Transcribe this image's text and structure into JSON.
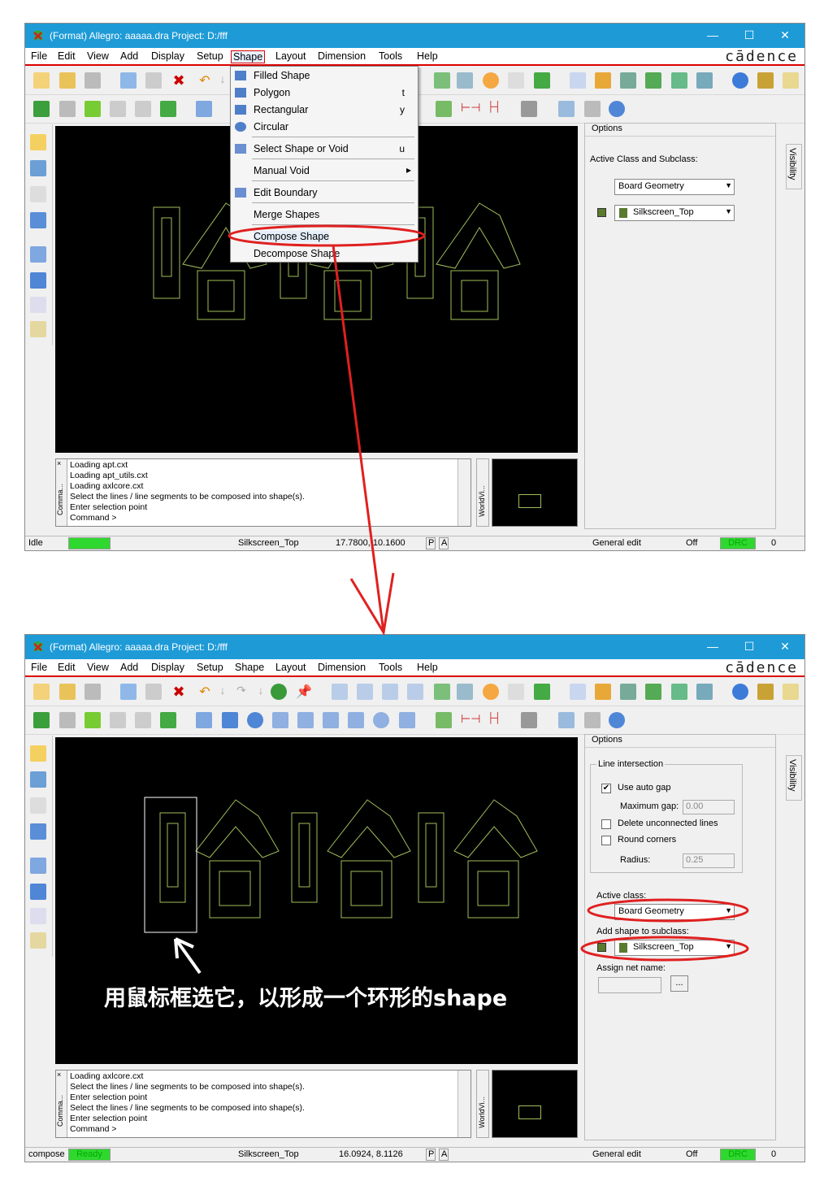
{
  "title": "(Format) Allegro: aaaaa.dra  Project: D:/fff",
  "brand": "cādence",
  "menubar": [
    "File",
    "Edit",
    "View",
    "Add",
    "Display",
    "Setup",
    "Shape",
    "Layout",
    "Dimension",
    "Tools",
    "Help"
  ],
  "shape_menu": {
    "items": [
      {
        "label": "Filled Shape",
        "shortcut": ""
      },
      {
        "label": "Polygon",
        "shortcut": "t"
      },
      {
        "label": "Rectangular",
        "shortcut": "y"
      },
      {
        "label": "Circular",
        "shortcut": ""
      },
      {
        "label": "Select Shape or Void",
        "shortcut": "u"
      },
      {
        "label": "Manual Void",
        "shortcut": "▸"
      },
      {
        "label": "Edit Boundary",
        "shortcut": ""
      },
      {
        "label": "Merge Shapes",
        "shortcut": ""
      },
      {
        "label": "Compose Shape",
        "shortcut": ""
      },
      {
        "label": "Decompose Shape",
        "shortcut": ""
      }
    ]
  },
  "window1": {
    "options_header": "Options",
    "active_class_label": "Active Class and Subclass:",
    "class": "Board Geometry",
    "subclass": "Silkscreen_Top",
    "console": [
      "Loading apt.cxt",
      "Loading apt_utils.cxt",
      "Loading axlcore.cxt",
      "Select the lines / line segments to be composed into shape(s).",
      "Enter selection point",
      "Command >"
    ],
    "status": {
      "state": "Idle",
      "subclass": "Silkscreen_Top",
      "coords": "17.7800, 10.1600",
      "p": "P",
      "a": "A",
      "mode": "General edit",
      "off": "Off",
      "drc": "DRC",
      "count": "0"
    }
  },
  "window2": {
    "options_header": "Options",
    "line_intersection": "Line intersection",
    "use_auto_gap": "Use auto gap",
    "maximum_gap_label": "Maximum gap:",
    "maximum_gap": "0.00",
    "delete_unconnected": "Delete unconnected lines",
    "round_corners": "Round corners",
    "radius_label": "Radius:",
    "radius": "0.25",
    "active_class_label": "Active class:",
    "class": "Board Geometry",
    "add_shape_label": "Add shape to subclass:",
    "subclass": "Silkscreen_Top",
    "assign_net_label": "Assign net name:",
    "browse": "...",
    "console": [
      "Loading axlcore.cxt",
      "Select the lines / line segments to be composed into shape(s).",
      "Enter selection point",
      "Select the lines / line segments to be composed into shape(s).",
      "Enter selection point",
      "Command >"
    ],
    "status": {
      "state": "compose",
      "ready": "Ready",
      "subclass": "Silkscreen_Top",
      "coords": "16.0924, 8.1126",
      "p": "P",
      "a": "A",
      "mode": "General edit",
      "off": "Off",
      "drc": "DRC",
      "count": "0"
    }
  },
  "console_tab": "Comma...",
  "world_tab": "WorldVi...",
  "visibility_tab": "Visibility",
  "caption": "用鼠标框选它，以形成一个环形的shape",
  "colors": {
    "titlebar": "#1e9bd7",
    "annotation": "#e02020",
    "silk": "#9fbe5a",
    "green": "#2fd82f"
  }
}
